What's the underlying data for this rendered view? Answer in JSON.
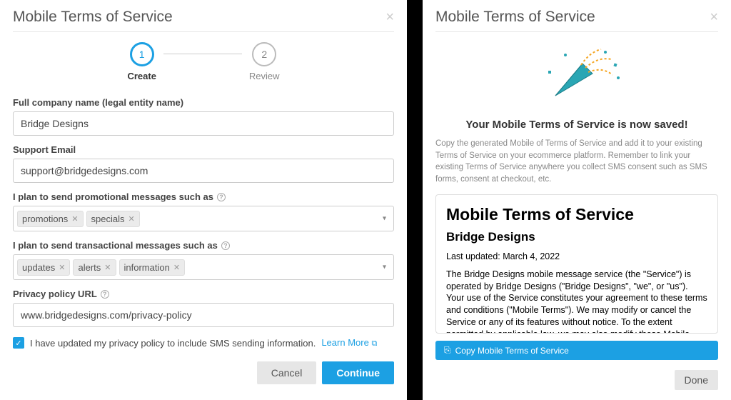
{
  "left": {
    "title": "Mobile Terms of Service",
    "stepper": {
      "step1_num": "1",
      "step1_label": "Create",
      "step2_num": "2",
      "step2_label": "Review"
    },
    "company_label": "Full company name (legal entity name)",
    "company_value": "Bridge Designs",
    "email_label": "Support Email",
    "email_value": "support@bridgedesigns.com",
    "promo_label": "I plan to send promotional messages such as",
    "promo_tags": [
      "promotions",
      "specials"
    ],
    "trans_label": "I plan to send transactional messages such as",
    "trans_tags": [
      "updates",
      "alerts",
      "information"
    ],
    "privacy_label": "Privacy policy URL",
    "privacy_value": "www.bridgedesigns.com/privacy-policy",
    "checkbox_text": "I have updated my privacy policy to include SMS sending information.",
    "learn_more": "Learn More",
    "cancel": "Cancel",
    "continue": "Continue"
  },
  "right": {
    "title": "Mobile Terms of Service",
    "saved_heading": "Your Mobile Terms of Service is now saved!",
    "saved_desc": "Copy the generated Mobile of Terms of Service and add it to your existing Terms of Service on your ecommerce platform. Remember to link your existing Terms of Service anywhere you collect SMS consent such as SMS forms, consent at checkout, etc.",
    "doc_title": "Mobile Terms of Service",
    "doc_company": "Bridge Designs",
    "doc_updated": "Last updated: March 4, 2022",
    "doc_body": "The Bridge Designs mobile message service (the \"Service\") is operated by Bridge Designs (\"Bridge Designs\", \"we\", or \"us\"). Your use of the Service constitutes your agreement to these terms and conditions (\"Mobile Terms\"). We may modify or cancel the Service or any of its features without notice. To the extent permitted by applicable law, we may also modify these Mobile Terms at any time and your continued use of the Service following the effective date of any such changes shall constitute your acceptance of such",
    "copy_btn": "Copy Mobile Terms of Service",
    "done": "Done"
  }
}
